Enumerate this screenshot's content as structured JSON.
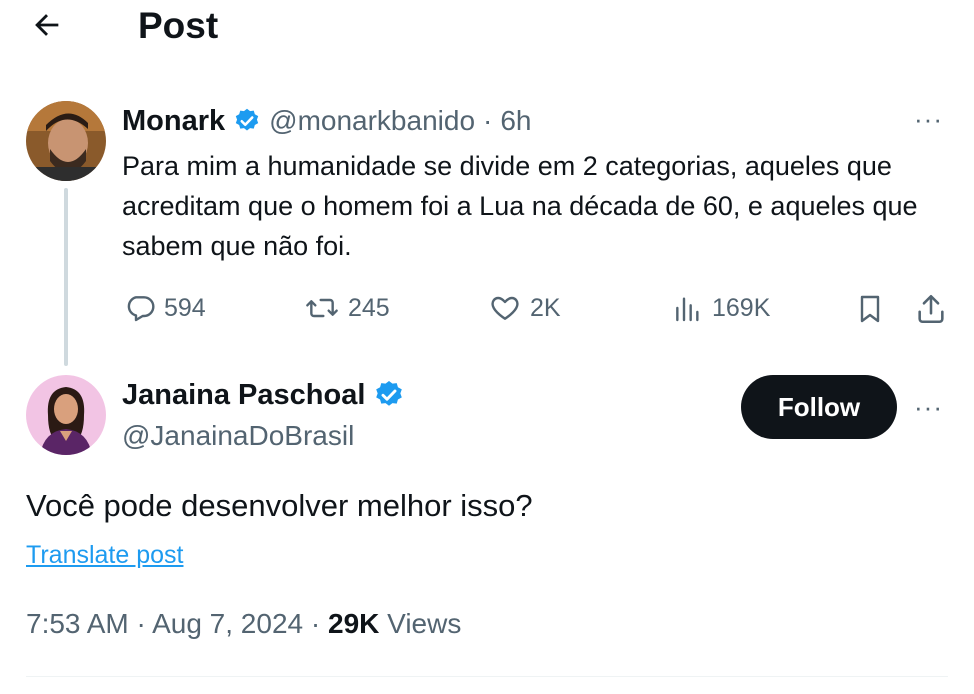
{
  "header": {
    "title": "Post"
  },
  "parent_post": {
    "author_name": "Monark",
    "handle": "@monarkbanido",
    "separator": "·",
    "time": "6h",
    "text": "Para mim a humanidade se divide em 2 categorias, aqueles que acreditam que o homem foi a Lua na década de 60, e aqueles que sabem que não foi.",
    "actions": {
      "replies": "594",
      "reposts": "245",
      "likes": "2K",
      "views": "169K"
    },
    "more": "···"
  },
  "main_post": {
    "author_name": "Janaina Paschoal",
    "handle": "@JanainaDoBrasil",
    "follow_label": "Follow",
    "more": "···",
    "text": "Você pode desenvolver melhor isso?",
    "translate_label": "Translate post",
    "time": "7:53 AM",
    "date": "Aug 7, 2024",
    "separator": "·",
    "views_count": "29K",
    "views_label": "Views"
  },
  "colors": {
    "accent": "#1d9bf0",
    "text": "#0f1419",
    "muted": "#536471",
    "button": "#0f1419"
  }
}
